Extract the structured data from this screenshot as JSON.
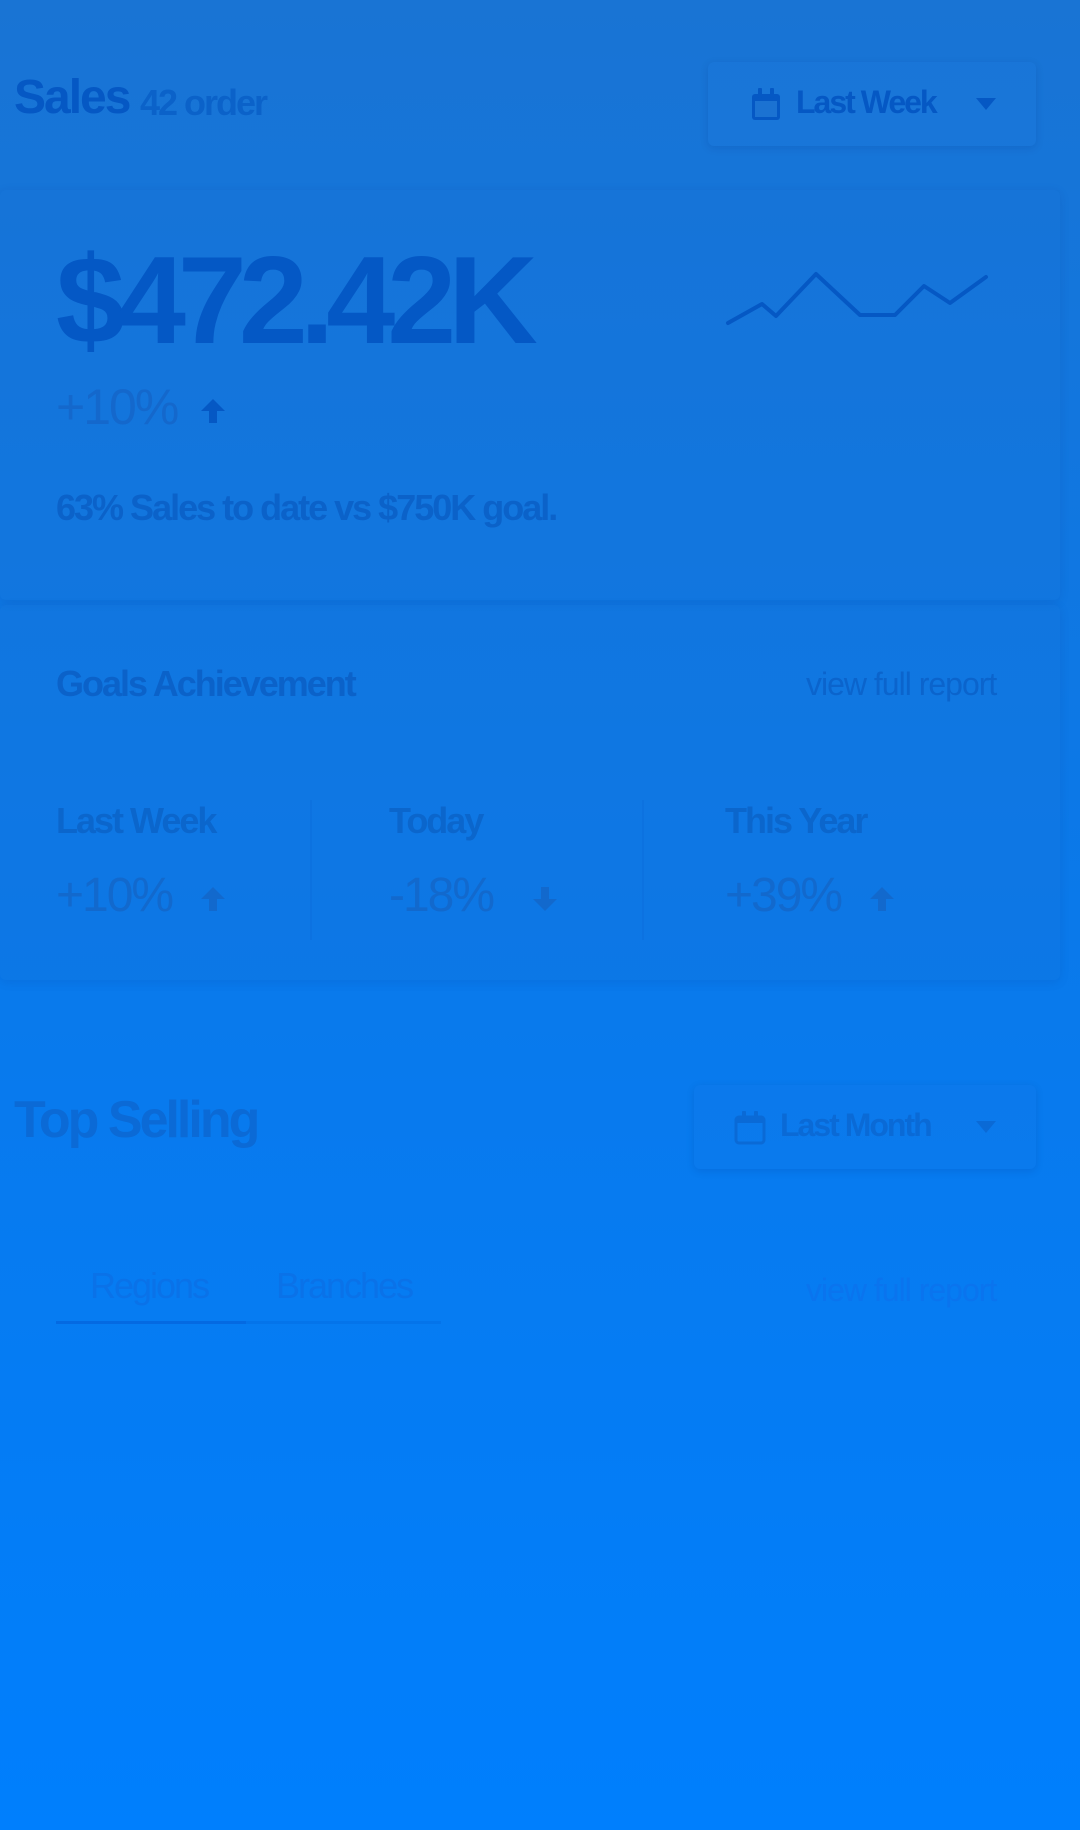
{
  "header": {
    "title": "Sales",
    "subtitle": "42 order",
    "period_dropdown": {
      "label": "Last Week",
      "icon": "calendar-icon"
    }
  },
  "summary": {
    "amount": "$472.42K",
    "change": "+10%",
    "change_direction": "up",
    "goal_text": "63% Sales to date vs $750K goal."
  },
  "goals": {
    "title": "Goals Achievement",
    "link": "view full report",
    "stats": [
      {
        "label": "Last Week",
        "value": "+10%",
        "direction": "up"
      },
      {
        "label": "Today",
        "value": "-18%",
        "direction": "down"
      },
      {
        "label": "This Year",
        "value": "+39%",
        "direction": "up"
      }
    ]
  },
  "top_selling": {
    "title": "Top Selling",
    "period_dropdown": {
      "label": "Last Month",
      "icon": "calendar-icon"
    },
    "tabs": [
      "Regions",
      "Branches"
    ],
    "active_tab": "Regions",
    "link": "view full report"
  },
  "colors": {
    "background_top": "#1974d4",
    "background_bottom": "#007ffd",
    "text_primary": "#0558c4"
  }
}
